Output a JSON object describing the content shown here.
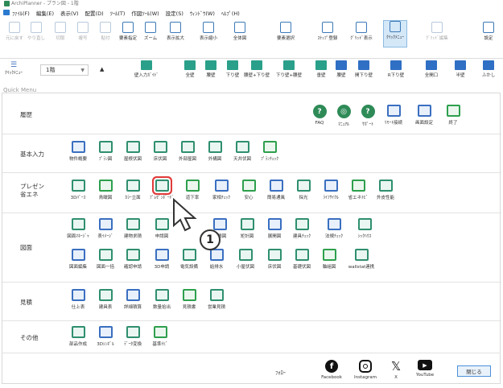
{
  "titlebar": {
    "title": "ArchiPlanner - プラン図 - 1階"
  },
  "menubar": {
    "items": [
      "ﾌｧｲﾙ(F)",
      "編集(E)",
      "表示(V)",
      "配置(D)",
      "ﾂｰﾙ(T)",
      "作図ﾂｰﾙ(W)",
      "設定(S)",
      "ｳｨﾝﾄﾞｳ(W)",
      "ﾍﾙﾌﾟ(H)"
    ]
  },
  "toolbar1": {
    "items": [
      "元に戻す",
      "やり直し",
      "切取",
      "複写",
      "貼付",
      "要素指定",
      "ズーム",
      "表示拡大",
      "表示縮小",
      "全体図",
      "要素選択",
      "ｽﾅｯﾌﾟ登録",
      "ｸﾞﾘｯﾄﾞ表示",
      "ｸｲｯｸﾒﾆｭｰ",
      "ｸﾞﾘｯﾄﾞ編集",
      "設定"
    ]
  },
  "toolbar2": {
    "menu_label": "ｸｲｯｸﾒﾆｭｰ",
    "floor": "1階",
    "items": [
      "壁入力ｶﾞｲﾄﾞ",
      "全壁",
      "腰壁",
      "下り壁",
      "腰壁+下り壁",
      "下り壁+腰壁",
      "垂壁",
      "腰壁",
      "開下り壁",
      "R下り壁",
      "全開口",
      "半壁",
      "ふかし"
    ]
  },
  "panel_title": "Quick Menu",
  "history": {
    "label": "履歴",
    "items": [
      "FAQ",
      "ﾏﾆｭｱﾙ",
      "ｻﾎﾟｰﾄ",
      "ﾘﾓｰﾄ接続",
      "画面設定",
      "終了"
    ]
  },
  "basic": {
    "label": "基本入力",
    "items": [
      "物件概要",
      "ﾌﾟﾗﾝ図",
      "屋根伏図",
      "床伏図",
      "外部屋図",
      "外構図",
      "天井伏図",
      "ﾌﾟﾗﾝﾁｪｯｸ"
    ]
  },
  "presen": {
    "label": "プレゼン\n省エネ",
    "items": [
      "3Dﾊﾟｰｽ",
      "鳥瞰図",
      "ｶﾗｰ立面",
      "ﾌﾟﾚｾﾞﾝﾎﾞｰﾄﾞ",
      "道下率",
      "家相ﾁｪｯｸ",
      "安心",
      "簡易通風",
      "採光",
      "ﾗｲﾌｻｲｸﾙ",
      "省エネﾅﾋﾞ",
      "外皮性能"
    ]
  },
  "drawing": {
    "label": "図面",
    "row1": [
      "図面ﾏﾈｰｼﾞｬ",
      "表ｲﾒｰｼﾞ",
      "建物求積",
      "申請図",
      "面積図",
      "矩計図",
      "展開図",
      "建具ﾁｪｯｸ",
      "法規ﾁｪｯｸ",
      "ｼｯｸﾊｳｽ"
    ],
    "row2": [
      "図面編集",
      "図面一括",
      "確認申請",
      "3D申請",
      "電気設備",
      "給排水",
      "小屋伏図",
      "床伏図",
      "基礎伏図",
      "軸組図",
      "wallstat連携"
    ]
  },
  "estimate": {
    "label": "見積",
    "items": [
      "仕上表",
      "建具表",
      "詳細積算",
      "数量拾出",
      "見積書",
      "営業見積"
    ]
  },
  "other": {
    "label": "その他",
    "items": [
      "部品作成",
      "3Dｼﾝﾎﾞﾙ",
      "ﾃﾞｰﾀ変換",
      "基準ﾅﾋﾞ"
    ]
  },
  "callout": "1",
  "footer": {
    "follow_label": "ﾌｫﾛｰ",
    "social": [
      "Facebook",
      "Instagram",
      "X",
      "YouTube"
    ],
    "close_label": "閉じる"
  },
  "colors": {
    "accent_green": "#2f8f6f",
    "accent_blue": "#3a6fc0",
    "highlight_red": "#e23a3a"
  }
}
